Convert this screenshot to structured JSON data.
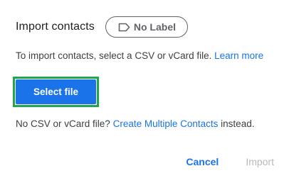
{
  "dialog": {
    "title": "Import contacts",
    "label_chip": {
      "icon": "label-outline-icon",
      "text": "No Label"
    },
    "description": {
      "text": "To import contacts, select a CSV or vCard file.",
      "link": "Learn more"
    },
    "select_file_label": "Select file",
    "no_csv": {
      "prefix": "No CSV or vCard file?",
      "link": "Create Multiple Contacts",
      "suffix": "instead."
    },
    "actions": {
      "cancel": "Cancel",
      "import": "Import"
    }
  },
  "colors": {
    "accent": "#1a73e8",
    "highlight": "#1fa849",
    "disabled": "#b5b9bd"
  }
}
